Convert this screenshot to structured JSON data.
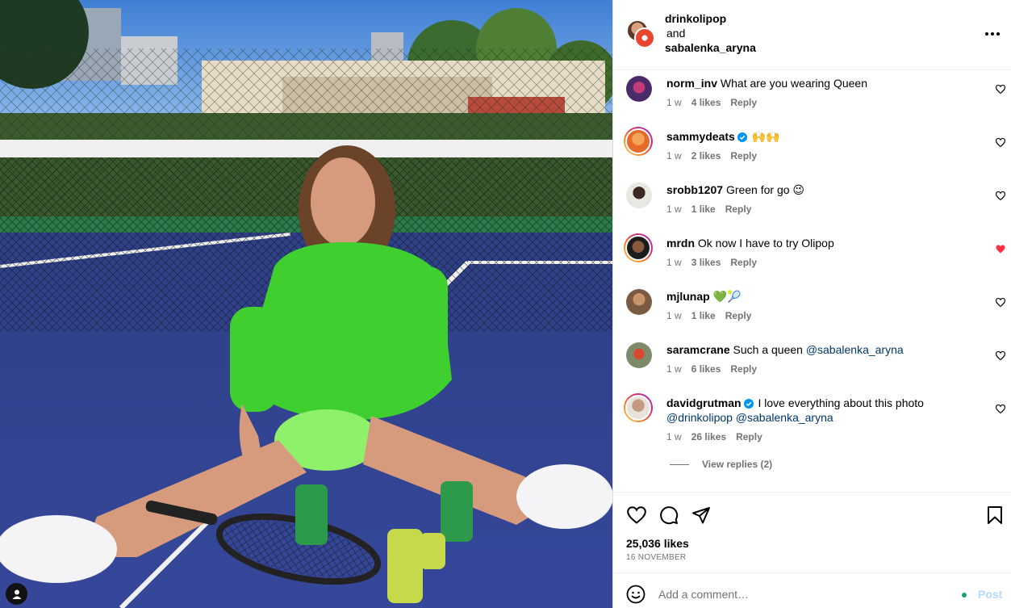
{
  "header": {
    "user1": "drinkolipop",
    "and": "and",
    "user2": "sabalenka_aryna"
  },
  "comments": [
    {
      "user": "norm_inv",
      "text": "What are you wearing Queen",
      "time": "1 w",
      "likes": "4 likes",
      "reply": "Reply",
      "liked": false,
      "verified": false
    },
    {
      "user": "sammydeats",
      "text": "🙌🙌",
      "time": "1 w",
      "likes": "2 likes",
      "reply": "Reply",
      "liked": false,
      "verified": true
    },
    {
      "user": "srobb1207",
      "text": "Green for go 😉",
      "time": "1 w",
      "likes": "1 like",
      "reply": "Reply",
      "liked": false,
      "verified": false
    },
    {
      "user": "mrdn",
      "text": "Ok now I have to try Olipop",
      "time": "1 w",
      "likes": "3 likes",
      "reply": "Reply",
      "liked": true,
      "verified": false
    },
    {
      "user": "mjlunap",
      "text": "💚🎾",
      "time": "1 w",
      "likes": "1 like",
      "reply": "Reply",
      "liked": false,
      "verified": false
    },
    {
      "user": "saramcrane",
      "text": "Such a queen",
      "mention": "@sabalenka_aryna",
      "time": "1 w",
      "likes": "6 likes",
      "reply": "Reply",
      "liked": false,
      "verified": false
    },
    {
      "user": "davidgrutman",
      "text": "I love everything about this photo",
      "mention1": "@drinkolipop",
      "mention2": "@sabalenka_aryna",
      "time": "1 w",
      "likes": "26 likes",
      "reply": "Reply",
      "liked": false,
      "verified": true
    }
  ],
  "view_replies": "View replies (2)",
  "post": {
    "likes": "25,036 likes",
    "date": "16 NOVEMBER"
  },
  "add_comment": {
    "placeholder": "Add a comment…",
    "post_label": "Post"
  },
  "colors": {
    "accent_blue": "#0095f6",
    "post_disabled": "#b3dbff",
    "heart_red": "#ff3040",
    "mention": "#00376b",
    "secondary_text": "#737373"
  },
  "icons": {
    "header_more": "more-horizontal-icon",
    "comment_like": "heart-outline-icon",
    "comment_liked": "heart-filled-icon",
    "verified": "verified-badge-icon",
    "like": "heart-icon",
    "comment": "comment-bubble-icon",
    "share": "paper-plane-icon",
    "save": "bookmark-icon",
    "emoji": "emoji-smile-icon",
    "tagged_user": "user-tag-icon"
  }
}
